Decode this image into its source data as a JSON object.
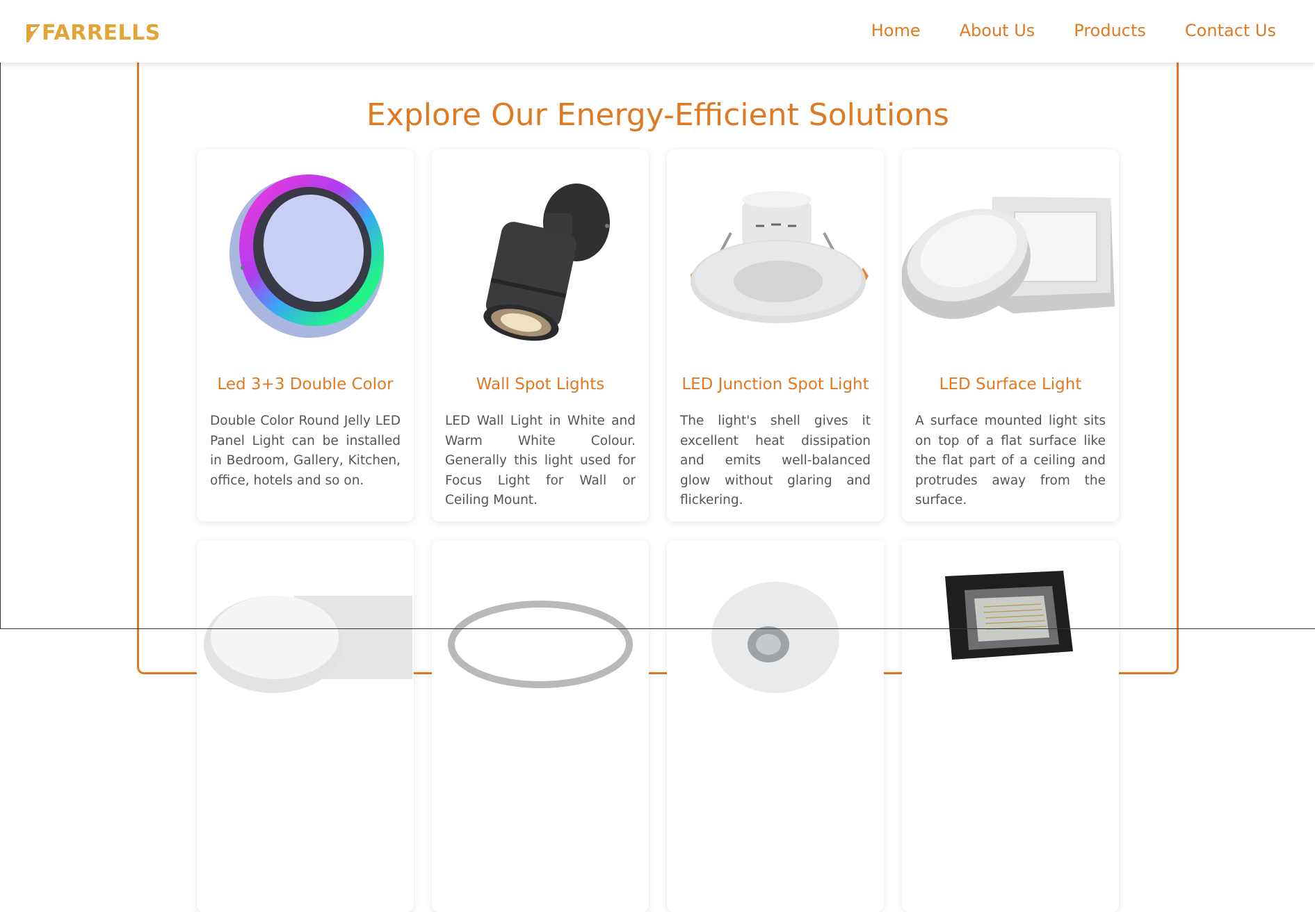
{
  "brand": {
    "name": "FARRELLS",
    "color": "#e2a437"
  },
  "colors": {
    "accent": "#e07a22",
    "text": "#555555",
    "background": "#ffffff"
  },
  "nav": {
    "items": [
      {
        "label": "Home"
      },
      {
        "label": "About Us"
      },
      {
        "label": "Products"
      },
      {
        "label": "Contact Us"
      }
    ]
  },
  "main": {
    "title": "Explore Our Energy-Efficient Solutions",
    "products": [
      {
        "title": "Led 3+3 Double Color",
        "description": "Double Color Round Jelly LED Panel Light can be installed in Bedroom, Gallery, Kitchen, office, hotels and so on.",
        "icon": "round-rgb-panel-light"
      },
      {
        "title": "Wall Spot Lights",
        "description": "LED Wall Light in White and Warm White Colour. Generally this light used for Focus Light for Wall or Ceiling Mount.",
        "icon": "wall-spot-light"
      },
      {
        "title": "LED Junction Spot Light",
        "description": "The light's shell gives it excellent heat dissipation and emits well-balanced glow without glaring and flickering.",
        "icon": "junction-spot-light"
      },
      {
        "title": "LED Surface Light",
        "description": "A surface mounted light sits on top of a flat surface like the flat part of a ceiling and protrudes away from the surface.",
        "icon": "surface-light"
      },
      {
        "title": "",
        "description": "",
        "icon": "surface-light"
      },
      {
        "title": "",
        "description": "",
        "icon": "ring-light"
      },
      {
        "title": "",
        "description": "",
        "icon": "downlight"
      },
      {
        "title": "",
        "description": "",
        "icon": "flood-light"
      }
    ]
  }
}
